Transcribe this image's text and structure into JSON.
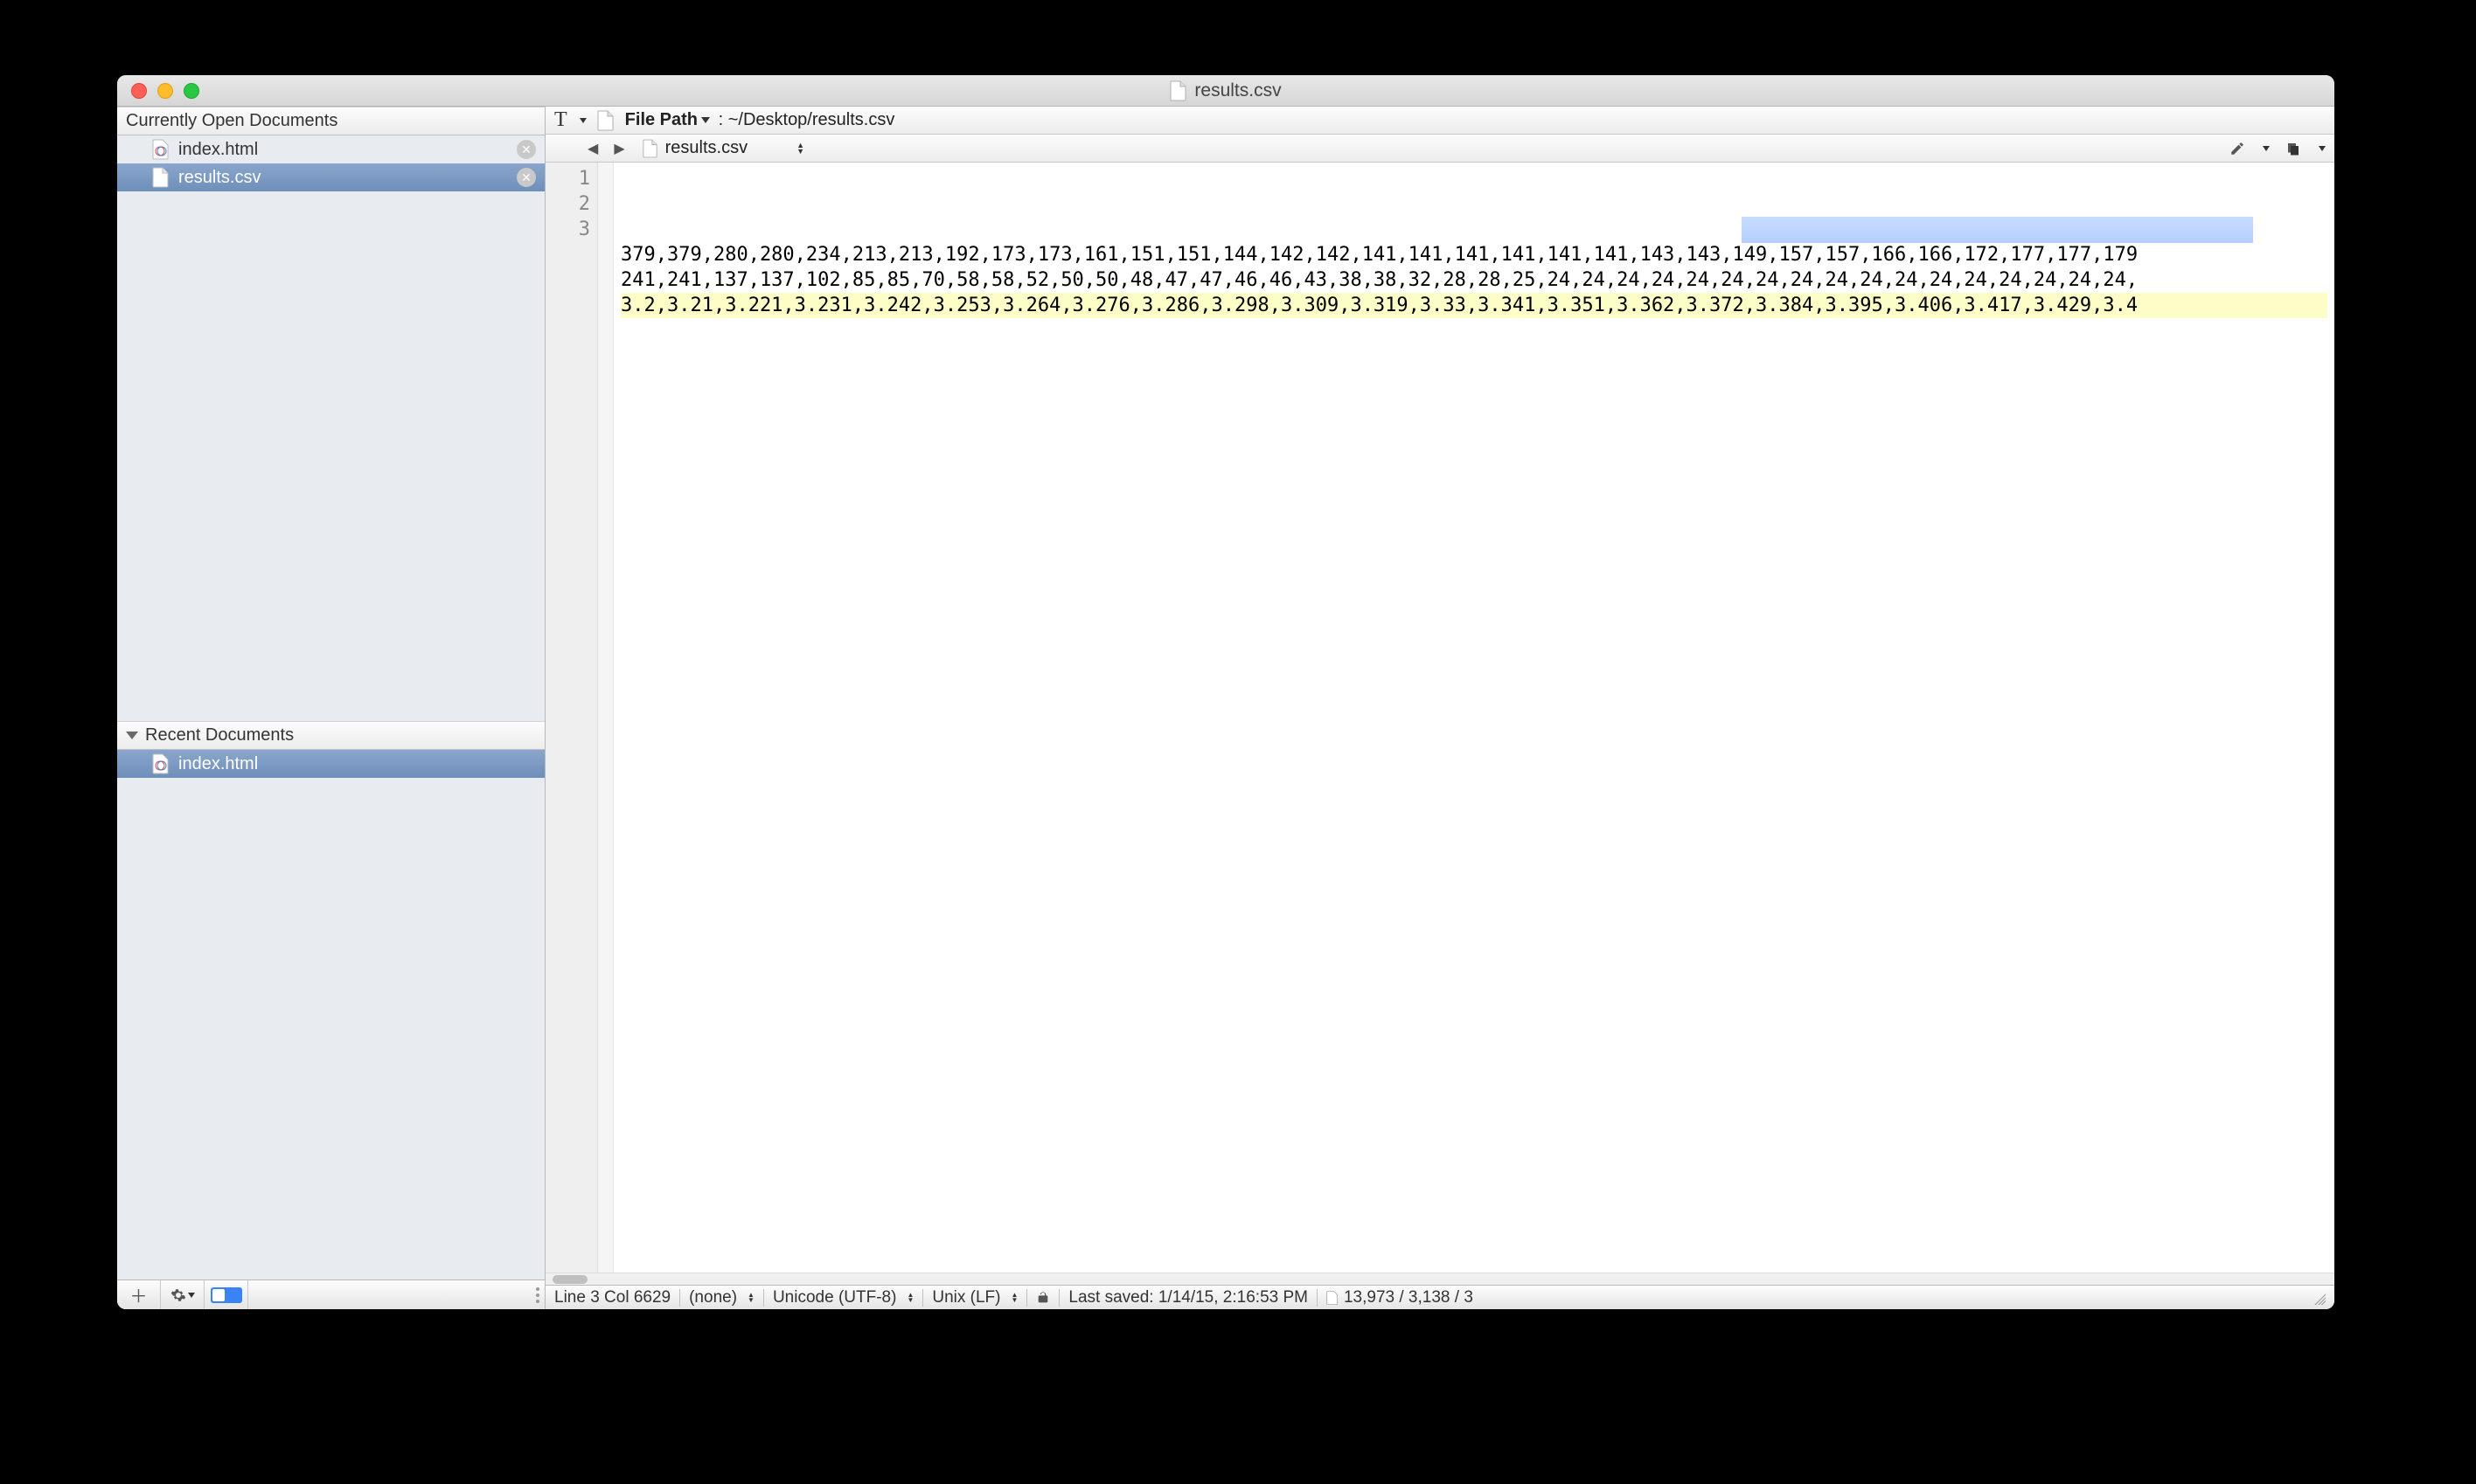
{
  "window": {
    "title": "results.csv"
  },
  "sidebar": {
    "open_header": "Currently Open Documents",
    "open_items": [
      {
        "label": "index.html",
        "icon": "html"
      },
      {
        "label": "results.csv",
        "icon": "file"
      }
    ],
    "recent_header": "Recent Documents",
    "recent_items": [
      {
        "label": "index.html",
        "icon": "html"
      }
    ]
  },
  "toolbar": {
    "filepath_prefix": "File Path",
    "filepath_sep": " : ",
    "filepath": "~/Desktop/results.csv",
    "breadcrumb_file": "results.csv"
  },
  "editor": {
    "line_numbers": [
      "1",
      "2",
      "3"
    ],
    "lines": [
      "379,379,280,280,234,213,213,192,173,173,161,151,151,144,142,142,141,141,141,141,141,141,143,143,149,157,157,166,166,172,177,177,179",
      "241,241,137,137,102,85,85,70,58,58,52,50,50,48,47,47,46,46,43,38,38,32,28,28,25,24,24,24,24,24,24,24,24,24,24,24,24,24,24,24,24,24,",
      "3.2,3.21,3.221,3.231,3.242,3.253,3.264,3.276,3.286,3.298,3.309,3.319,3.33,3.341,3.351,3.362,3.372,3.384,3.395,3.406,3.417,3.429,3.4"
    ]
  },
  "statusbar": {
    "cursor": "Line 3 Col 6629",
    "language": "(none)",
    "encoding": "Unicode (UTF-8)",
    "line_ending": "Unix (LF)",
    "last_saved": "Last saved: 1/14/15, 2:16:53 PM",
    "counts": "13,973 / 3,138 / 3"
  }
}
